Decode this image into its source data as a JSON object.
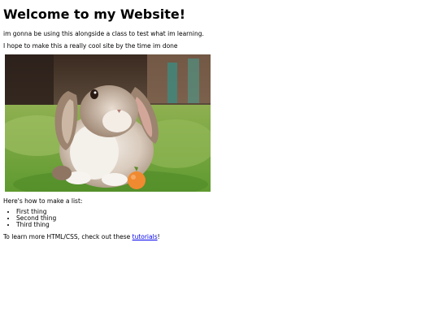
{
  "page": {
    "heading": "Welcome to my Website!",
    "intro_line_1": "im gonna be using this alongside a class to test what im learning.",
    "intro_line_2": "I hope to make this a really cool site by the time im done",
    "list_intro": "Here's how to make a list:",
    "list_items": [
      "First thing",
      "Second thing",
      "Third thing"
    ],
    "outro_prefix": "To learn more HTML/CSS, check out these ",
    "outro_link": "tutorials",
    "outro_suffix": "!"
  },
  "image": {
    "subject": "rabbit-photo"
  },
  "colors": {
    "link": "#0000ee",
    "text": "#000000",
    "background": "#ffffff"
  }
}
